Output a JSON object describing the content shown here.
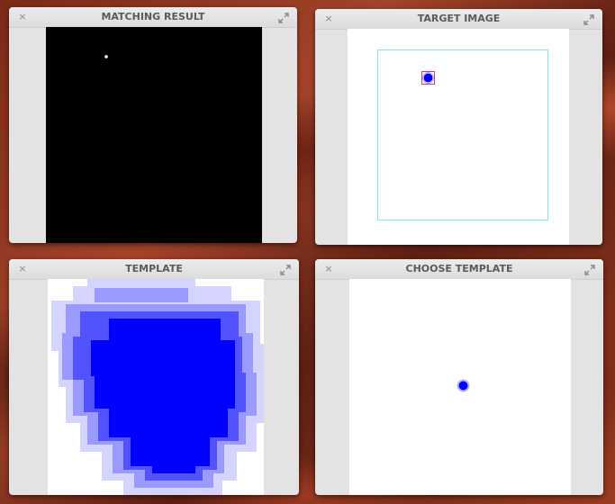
{
  "windows": {
    "matching_result": {
      "title": "MATCHING RESULT",
      "close_glyph": "×",
      "canvas_background": "#000000",
      "peak_color": "#ffffff"
    },
    "target_image": {
      "title": "TARGET IMAGE",
      "close_glyph": "×",
      "canvas_background": "#ffffff",
      "roi_color": "#7fe6f0",
      "match_box_color": "#d9357a",
      "blob_color": "#0000ff"
    },
    "template": {
      "title": "TEMPLATE",
      "close_glyph": "×",
      "canvas_background": "#ffffff",
      "blob_color": "#0000ff"
    },
    "choose_template": {
      "title": "CHOOSE TEMPLATE",
      "close_glyph": "×",
      "canvas_background": "#ffffff",
      "blob_color": "#0000ff"
    }
  },
  "icons": {
    "close": "close-icon",
    "maximize": "maximize-icon"
  }
}
